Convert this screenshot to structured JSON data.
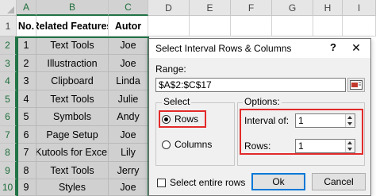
{
  "spreadsheet": {
    "columns": [
      "A",
      "B",
      "C",
      "D",
      "E",
      "F",
      "G",
      "H",
      "I"
    ],
    "rows": [
      "1",
      "2",
      "3",
      "4",
      "5",
      "6",
      "7",
      "8",
      "9",
      "10"
    ],
    "headers": {
      "no": "No.",
      "feature": "Related Features",
      "autor": "Autor"
    },
    "data": [
      {
        "no": "1",
        "feature": "Text Tools",
        "autor": "Joe"
      },
      {
        "no": "2",
        "feature": "Illustraction",
        "autor": "Joe"
      },
      {
        "no": "3",
        "feature": "Clipboard",
        "autor": "Linda"
      },
      {
        "no": "4",
        "feature": "Text Tools",
        "autor": "Julie"
      },
      {
        "no": "5",
        "feature": "Symbols",
        "autor": "Andy"
      },
      {
        "no": "6",
        "feature": "Page Setup",
        "autor": "Joe"
      },
      {
        "no": "7",
        "feature": "Kutools for Excel",
        "autor": "Lily"
      },
      {
        "no": "8",
        "feature": "Text Tools",
        "autor": "Jerry"
      },
      {
        "no": "9",
        "feature": "Styles",
        "autor": "Joe"
      }
    ],
    "selection_color": "#217346",
    "shade_color": "#d0d0d0"
  },
  "dialog": {
    "title": "Select Interval Rows & Columns",
    "help_icon": "?",
    "close_icon": "✕",
    "range_label": "Range:",
    "range_value": "$A$2:$C$17",
    "range_button_icon": "range-select-icon",
    "select_group_label": "Select",
    "rows_label": "Rows",
    "rows_selected": true,
    "columns_label": "Columns",
    "columns_selected": false,
    "options_group_label": "Options:",
    "interval_label": "Interval of:",
    "interval_value": "1",
    "rows_count_label": "Rows:",
    "rows_count_value": "1",
    "select_entire_rows_label": "Select entire rows",
    "select_entire_rows_checked": false,
    "ok_label": "Ok",
    "cancel_label": "Cancel",
    "highlight_color": "#e32a2a"
  }
}
